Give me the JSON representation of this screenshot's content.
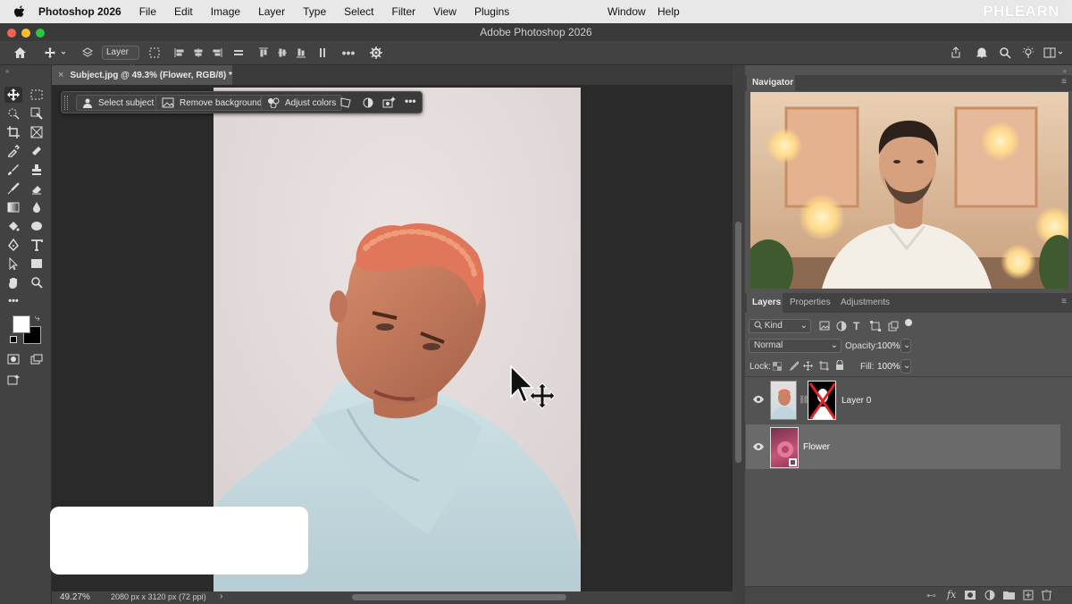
{
  "menubar": {
    "app_name": "Photoshop 2026",
    "items": [
      "File",
      "Edit",
      "Image",
      "Layer",
      "Type",
      "Select",
      "Filter",
      "View",
      "Plugins"
    ],
    "right_items": [
      "Window",
      "Help"
    ],
    "brand": "PHLEARN"
  },
  "window": {
    "title": "Adobe Photoshop 2026"
  },
  "options": {
    "layer_select": "Layer"
  },
  "document": {
    "tab_label": "Subject.jpg @ 49.3% (Flower, RGB/8) *"
  },
  "context_bar": {
    "select_subject": "Select subject",
    "remove_background": "Remove background",
    "adjust_colors": "Adjust colors"
  },
  "status": {
    "zoom": "49.27%",
    "doc_size": "2080 px x 3120 px (72 ppi)",
    "arrow": "›"
  },
  "navigator": {
    "tab": "Navigator"
  },
  "layers_panel": {
    "tabs": [
      "Layers",
      "Properties",
      "Adjustments"
    ],
    "filter_kind": "Kind",
    "blend_mode": "Normal",
    "opacity_label": "Opacity:",
    "opacity_value": "100%",
    "lock_label": "Lock:",
    "fill_label": "Fill:",
    "fill_value": "100%",
    "layers": [
      {
        "name": "Layer 0",
        "visible": true,
        "selected": false
      },
      {
        "name": "Flower",
        "visible": true,
        "selected": true
      }
    ]
  },
  "colors": {
    "accent": "#2d8cf0",
    "panel_bg": "#535353",
    "toolbar_bg": "#424242",
    "selected_layer": "#6a6a6a"
  }
}
